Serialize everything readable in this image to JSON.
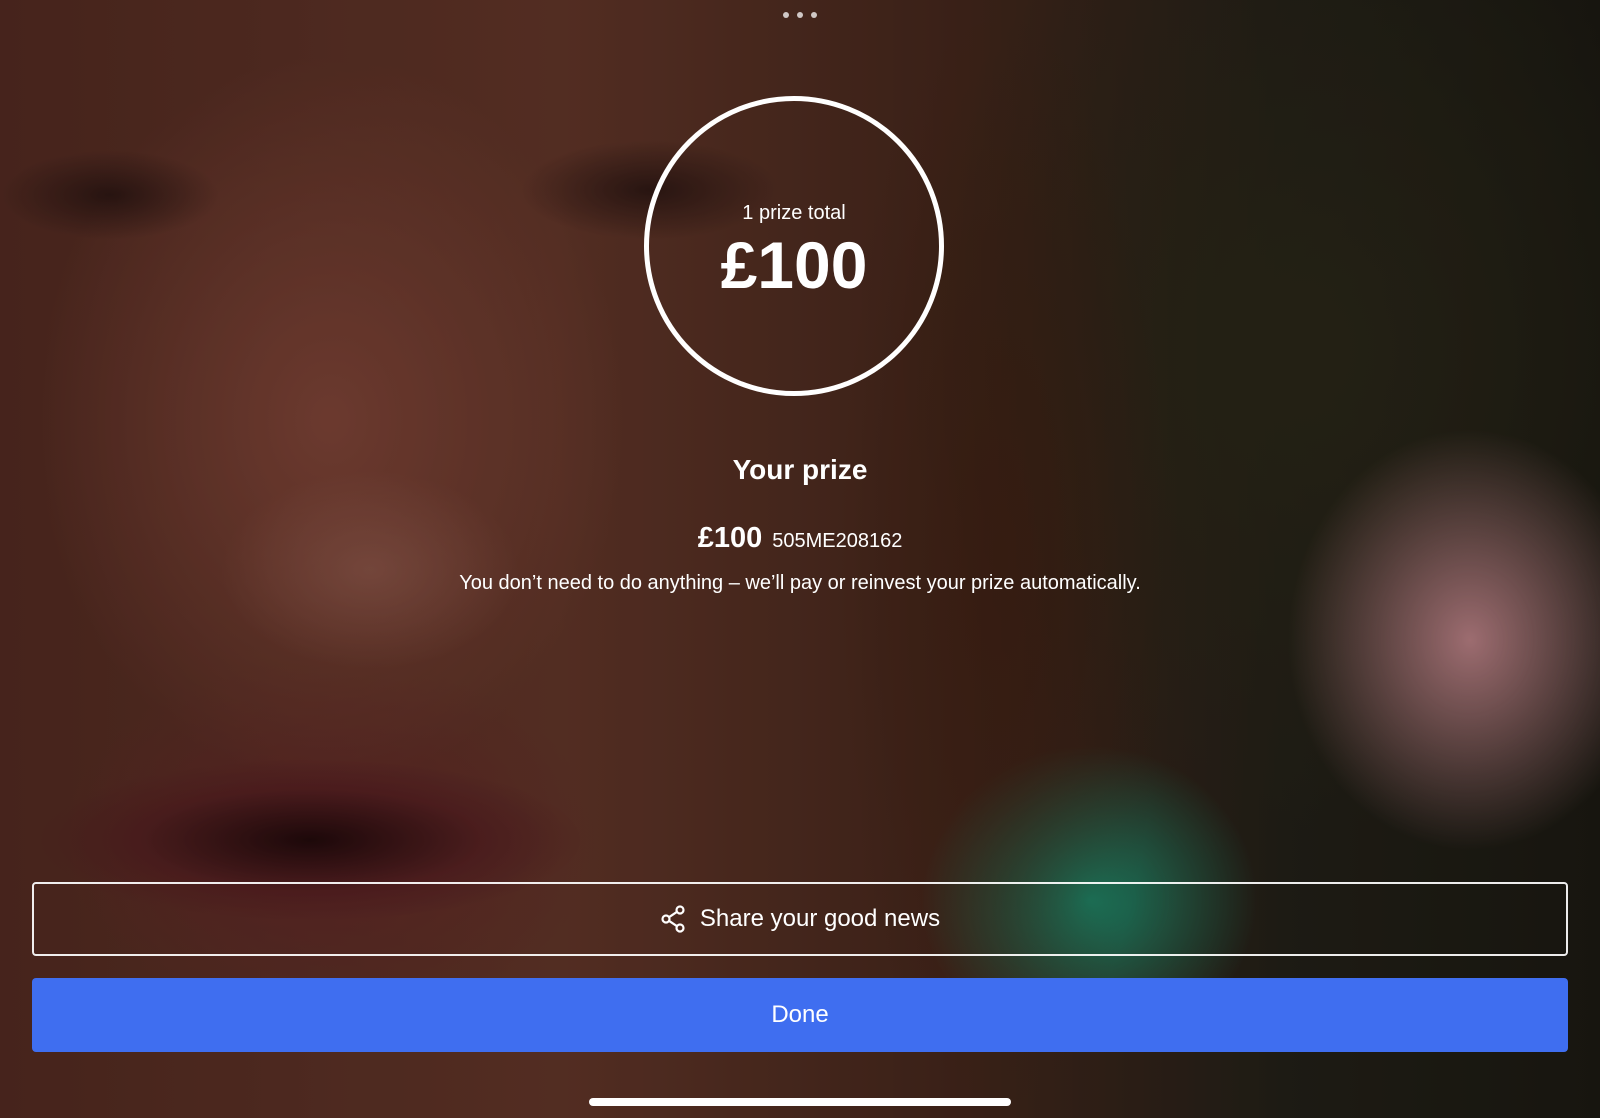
{
  "prize_total": {
    "caption": "1 prize total",
    "amount": "£100"
  },
  "title": "Your prize",
  "prize": {
    "amount": "£100",
    "bond_number": "505ME208162"
  },
  "note": "You don’t need to do anything – we’ll pay or reinvest your prize automatically.",
  "buttons": {
    "share_label": "Share your good news",
    "share_icon": "share-icon",
    "done_label": "Done"
  },
  "colors": {
    "primary": "#3f6ef0",
    "text": "#ffffff"
  }
}
